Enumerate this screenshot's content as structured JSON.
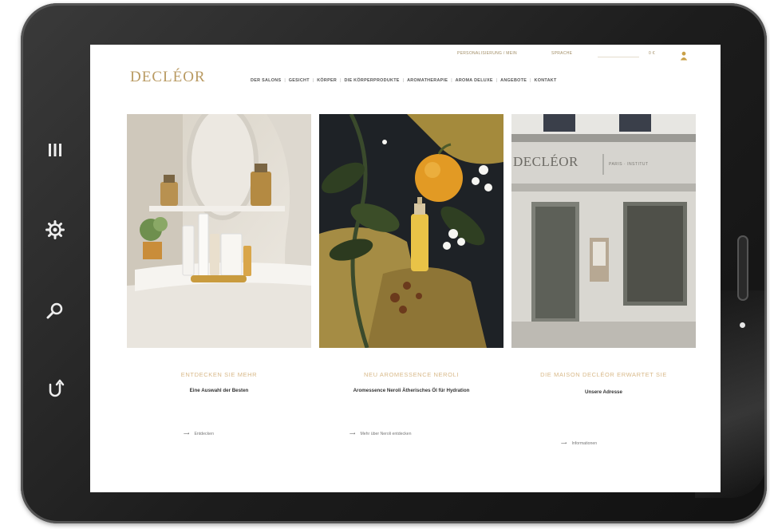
{
  "site": {
    "logo": "DECLÉOR",
    "utility": {
      "link1": "PERSONALISIERUNG / MEIN",
      "link2": "SPRACHE",
      "cart": "0 €"
    },
    "nav": [
      "DER SALONS",
      "GESICHT",
      "KÖRPER",
      "DIE KÖRPERPRODUKTE",
      "AROMATHERAPIE",
      "AROMA DELUXE",
      "ANGEBOTE",
      "KONTAKT"
    ]
  },
  "cards": [
    {
      "title": "ENTDECKEN SIE MEHR",
      "subtitle": "Eine Auswahl der Besten",
      "link": "Entdecken"
    },
    {
      "title": "NEU AROMESSENCE NEROLI",
      "subtitle": "Aromessence Neroli Ätherisches Öl für Hydration",
      "link": "Mehr über Neroli entdecken"
    },
    {
      "title": "DIE MAISON DECLÉOR ERWARTET SIE",
      "subtitle": "Unsere Adresse",
      "link": "Informationen"
    }
  ],
  "storefront": {
    "sign": "DECLÉOR",
    "sign_sub": "PARIS · INSTITUT"
  },
  "side_icons": [
    "menu-icon",
    "gear-icon",
    "search-icon",
    "undo-icon"
  ],
  "colors": {
    "accent": "#b99a62",
    "bezel": "#1f1f1f"
  }
}
